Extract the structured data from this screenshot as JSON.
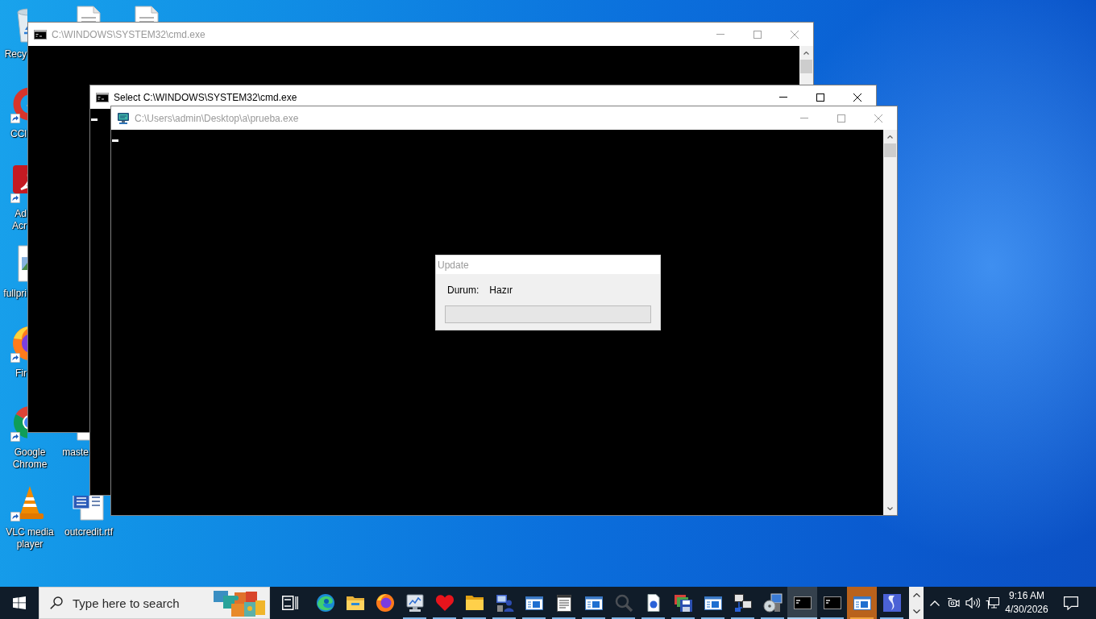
{
  "desktop": {
    "icons": [
      {
        "label": "Recy",
        "shortcut": false
      },
      {
        "label": "CCl",
        "shortcut": true
      },
      {
        "label": "Ad Acr",
        "shortcut": true
      },
      {
        "label": "fullpri",
        "shortcut": false
      },
      {
        "label": "Fir",
        "shortcut": true
      },
      {
        "label": "Google Chrome",
        "shortcut": true
      },
      {
        "label": "VLC media player",
        "shortcut": true
      },
      {
        "label": "maste"
      },
      {
        "label": "outcredit.rtf",
        "shortcut": false
      }
    ]
  },
  "windows": [
    {
      "title": "C:\\WINDOWS\\SYSTEM32\\cmd.exe",
      "active": false
    },
    {
      "title": "Select C:\\WINDOWS\\SYSTEM32\\cmd.exe",
      "active": true
    },
    {
      "title": "C:\\Users\\admin\\Desktop\\a\\prueba.exe",
      "active": false
    }
  ],
  "dialog": {
    "title": "Update",
    "active": false,
    "status_label": "Durum:",
    "status_value": "Hazır",
    "progress": {
      "level": 0
    }
  },
  "taskbar": {
    "search": {
      "placeholder": "Type here to search"
    },
    "apps": [
      {
        "running": false,
        "selected": false,
        "flashing": false
      },
      {
        "running": false,
        "selected": false,
        "flashing": false
      },
      {
        "running": false,
        "selected": false,
        "flashing": false
      },
      {
        "running": true,
        "selected": false,
        "flashing": false
      },
      {
        "running": true,
        "selected": false,
        "flashing": false
      },
      {
        "running": true,
        "selected": false,
        "flashing": false
      },
      {
        "running": true,
        "selected": false,
        "flashing": false
      },
      {
        "running": true,
        "selected": false,
        "flashing": false
      },
      {
        "running": true,
        "selected": false,
        "flashing": false
      },
      {
        "running": true,
        "selected": false,
        "flashing": false
      },
      {
        "running": true,
        "selected": false,
        "flashing": false
      },
      {
        "running": true,
        "selected": false,
        "flashing": false
      },
      {
        "running": true,
        "selected": false,
        "flashing": false
      },
      {
        "running": true,
        "selected": false,
        "flashing": false
      },
      {
        "running": true,
        "selected": false,
        "flashing": false
      },
      {
        "running": true,
        "selected": false,
        "flashing": false
      },
      {
        "running": true,
        "selected": true,
        "flashing": false
      },
      {
        "running": true,
        "selected": false,
        "flashing": false
      },
      {
        "running": true,
        "selected": false,
        "flashing": true
      },
      {
        "running": true,
        "selected": false,
        "flashing": false
      }
    ],
    "clock": {
      "time": "9:16 AM",
      "date": "4/30/2026"
    }
  }
}
